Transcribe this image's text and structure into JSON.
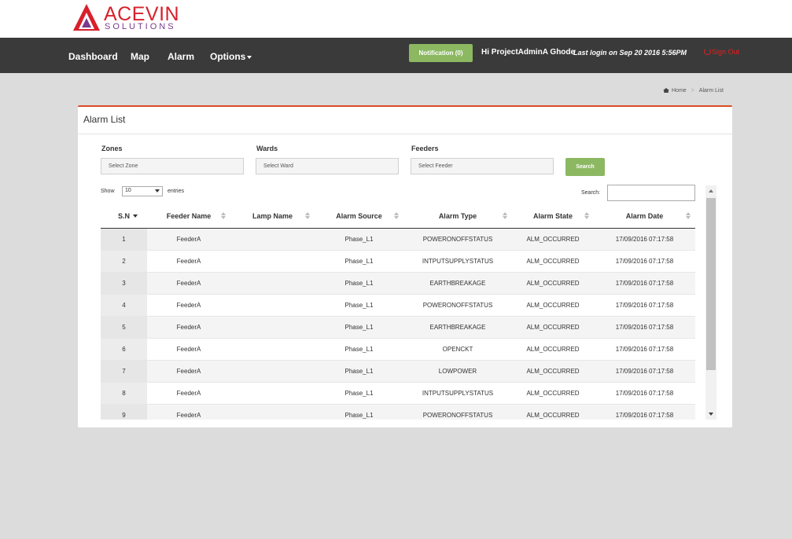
{
  "brand": {
    "name": "ACEVIN",
    "tagline": "SOLUTIONS"
  },
  "nav": {
    "items": [
      {
        "label": "Dashboard"
      },
      {
        "label": "Map"
      },
      {
        "label": "Alarm"
      },
      {
        "label": "Options"
      }
    ],
    "notification_label": "Notification (0)",
    "greeting": "Hi ProjectAdminA Ghode",
    "last_login": "Last login on Sep 20 2016 5:56PM",
    "signout_label": "Sign Out"
  },
  "breadcrumb": {
    "home": "Home",
    "separator": ">",
    "current": "Alarm List"
  },
  "panel": {
    "title": "Alarm List"
  },
  "filters": {
    "zones": {
      "label": "Zones",
      "value": "Select Zone"
    },
    "wards": {
      "label": "Wards",
      "value": "Select Ward"
    },
    "feeders": {
      "label": "Feeders",
      "value": "Select Feeder"
    },
    "search_button": "Search"
  },
  "table_controls": {
    "show_label": "Show",
    "page_length": "10",
    "entries_label": "entries",
    "search_label": "Search:",
    "search_value": ""
  },
  "columns": [
    "S.N",
    "Feeder Name",
    "Lamp Name",
    "Alarm Source",
    "Alarm Type",
    "Alarm State",
    "Alarm Date"
  ],
  "rows": [
    {
      "sn": "1",
      "feeder": "FeederA",
      "lamp": "",
      "source": "Phase_L1",
      "type": "POWERONOFFSTATUS",
      "state": "ALM_OCCURRED",
      "date": "17/09/2016 07:17:58"
    },
    {
      "sn": "2",
      "feeder": "FeederA",
      "lamp": "",
      "source": "Phase_L1",
      "type": "INTPUTSUPPLYSTATUS",
      "state": "ALM_OCCURRED",
      "date": "17/09/2016 07:17:58"
    },
    {
      "sn": "3",
      "feeder": "FeederA",
      "lamp": "",
      "source": "Phase_L1",
      "type": "EARTHBREAKAGE",
      "state": "ALM_OCCURRED",
      "date": "17/09/2016 07:17:58"
    },
    {
      "sn": "4",
      "feeder": "FeederA",
      "lamp": "",
      "source": "Phase_L1",
      "type": "POWERONOFFSTATUS",
      "state": "ALM_OCCURRED",
      "date": "17/09/2016 07:17:58"
    },
    {
      "sn": "5",
      "feeder": "FeederA",
      "lamp": "",
      "source": "Phase_L1",
      "type": "EARTHBREAKAGE",
      "state": "ALM_OCCURRED",
      "date": "17/09/2016 07:17:58"
    },
    {
      "sn": "6",
      "feeder": "FeederA",
      "lamp": "",
      "source": "Phase_L1",
      "type": "OPENCKT",
      "state": "ALM_OCCURRED",
      "date": "17/09/2016 07:17:58"
    },
    {
      "sn": "7",
      "feeder": "FeederA",
      "lamp": "",
      "source": "Phase_L1",
      "type": "LOWPOWER",
      "state": "ALM_OCCURRED",
      "date": "17/09/2016 07:17:58"
    },
    {
      "sn": "8",
      "feeder": "FeederA",
      "lamp": "",
      "source": "Phase_L1",
      "type": "INTPUTSUPPLYSTATUS",
      "state": "ALM_OCCURRED",
      "date": "17/09/2016 07:17:58"
    },
    {
      "sn": "9",
      "feeder": "FeederA",
      "lamp": "",
      "source": "Phase_L1",
      "type": "POWERONOFFSTATUS",
      "state": "ALM_OCCURRED",
      "date": "17/09/2016 07:17:58"
    }
  ],
  "colors": {
    "accent_green": "#8cb862",
    "navbar": "#3a3a3a",
    "panel_border": "#d94c24",
    "signout": "#e02020"
  }
}
